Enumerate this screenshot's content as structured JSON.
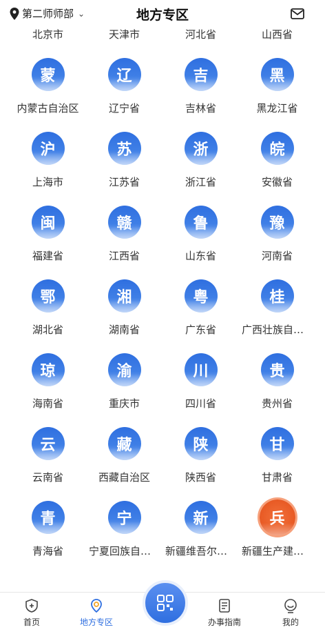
{
  "header": {
    "location": "第二师师部",
    "title": "地方专区"
  },
  "regions": [
    {
      "char": "",
      "label": "北京市"
    },
    {
      "char": "",
      "label": "天津市"
    },
    {
      "char": "",
      "label": "河北省"
    },
    {
      "char": "",
      "label": "山西省"
    },
    {
      "char": "蒙",
      "label": "内蒙古自治区"
    },
    {
      "char": "辽",
      "label": "辽宁省"
    },
    {
      "char": "吉",
      "label": "吉林省"
    },
    {
      "char": "黑",
      "label": "黑龙江省"
    },
    {
      "char": "沪",
      "label": "上海市"
    },
    {
      "char": "苏",
      "label": "江苏省"
    },
    {
      "char": "浙",
      "label": "浙江省"
    },
    {
      "char": "皖",
      "label": "安徽省"
    },
    {
      "char": "闽",
      "label": "福建省"
    },
    {
      "char": "赣",
      "label": "江西省"
    },
    {
      "char": "鲁",
      "label": "山东省"
    },
    {
      "char": "豫",
      "label": "河南省"
    },
    {
      "char": "鄂",
      "label": "湖北省"
    },
    {
      "char": "湘",
      "label": "湖南省"
    },
    {
      "char": "粤",
      "label": "广东省"
    },
    {
      "char": "桂",
      "label": "广西壮族自治区"
    },
    {
      "char": "琼",
      "label": "海南省"
    },
    {
      "char": "渝",
      "label": "重庆市"
    },
    {
      "char": "川",
      "label": "四川省"
    },
    {
      "char": "贵",
      "label": "贵州省"
    },
    {
      "char": "云",
      "label": "云南省"
    },
    {
      "char": "藏",
      "label": "西藏自治区"
    },
    {
      "char": "陕",
      "label": "陕西省"
    },
    {
      "char": "甘",
      "label": "甘肃省"
    },
    {
      "char": "青",
      "label": "青海省"
    },
    {
      "char": "宁",
      "label": "宁夏回族自治区"
    },
    {
      "char": "新",
      "label": "新疆维吾尔自治区"
    },
    {
      "char": "兵",
      "label": "新疆生产建设兵团",
      "special": true
    }
  ],
  "tabbar": {
    "home": "首页",
    "local": "地方专区",
    "guide": "办事指南",
    "mine": "我的"
  },
  "colors": {
    "accent": "#2f6fe0",
    "special": "#e85a24"
  }
}
